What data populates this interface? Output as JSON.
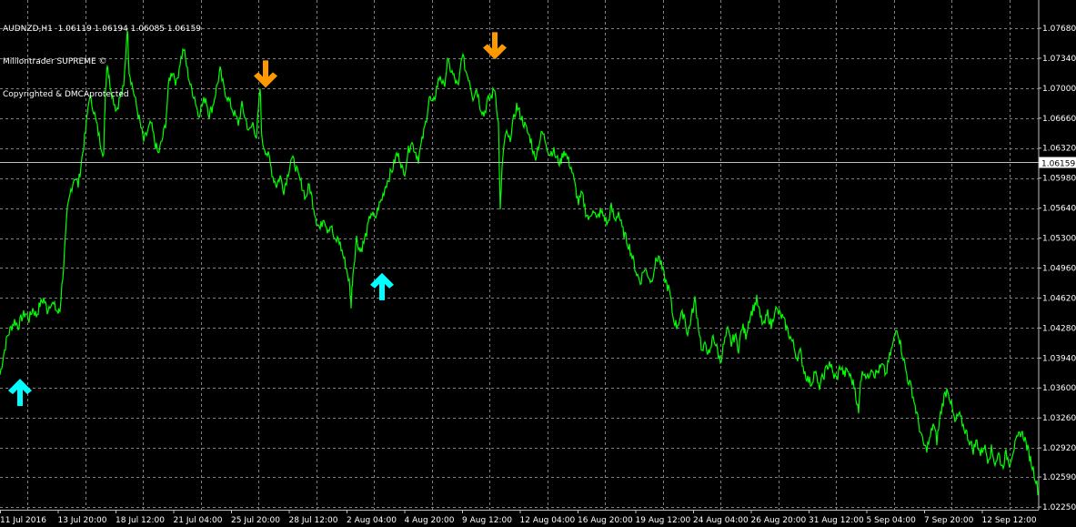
{
  "header": {
    "symbol_line": "AUDNZD,H1  1.06119 1.06194 1.06085 1.06159",
    "indicator_name": "Milliontrader SUPREME ©",
    "copyright": "Copyrighted & DMCAprotected"
  },
  "colors": {
    "background": "#000000",
    "grid": "#7f7f7f",
    "price_line": "#00ff00",
    "buy_arrow": "#00ffff",
    "sell_arrow": "#ff9900",
    "current_price_line": "#c0c0c0",
    "axis_text": "#ffffff"
  },
  "chart_data": {
    "type": "line",
    "symbol": "AUDNZD",
    "timeframe": "H1",
    "ohlc_last": {
      "open": 1.06119,
      "high": 1.06194,
      "low": 1.06085,
      "close": 1.06159
    },
    "current_price": 1.06159,
    "current_price_label": "1.06159",
    "ylim": [
      1.0225,
      1.079
    ],
    "y_ticks": [
      "1.07680",
      "1.07340",
      "1.07000",
      "1.06660",
      "1.06320",
      "1.05980",
      "1.05640",
      "1.05300",
      "1.04960",
      "1.04620",
      "1.04280",
      "1.03940",
      "1.03600",
      "1.03260",
      "1.02920",
      "1.02590",
      "1.02250"
    ],
    "x_ticks": [
      "11 Jul 2016",
      "13 Jul 20:00",
      "18 Jul 12:00",
      "21 Jul 04:00",
      "25 Jul 20:00",
      "28 Jul 12:00",
      "2 Aug 04:00",
      "4 Aug 20:00",
      "9 Aug 12:00",
      "12 Aug 04:00",
      "16 Aug 20:00",
      "19 Aug 12:00",
      "24 Aug 04:00",
      "26 Aug 20:00",
      "31 Aug 12:00",
      "5 Sep 04:00",
      "7 Sep 20:00",
      "12 Sep 12:00"
    ],
    "x_range": [
      0,
      1140
    ],
    "x_tick_positions": [
      0,
      63.5,
      127,
      190.5,
      254,
      317.5,
      381,
      444.5,
      508,
      571.5,
      635,
      698.5,
      762,
      825.5,
      889,
      952.5,
      1016,
      1079.5
    ],
    "series": [
      {
        "points": [
          [
            0,
            1.0375
          ],
          [
            4,
            1.0398
          ],
          [
            8,
            1.0418
          ],
          [
            12,
            1.0428
          ],
          [
            16,
            1.0436
          ],
          [
            20,
            1.043
          ],
          [
            24,
            1.044
          ],
          [
            28,
            1.0445
          ],
          [
            32,
            1.0438
          ],
          [
            36,
            1.045
          ],
          [
            40,
            1.0442
          ],
          [
            44,
            1.0455
          ],
          [
            48,
            1.0461
          ],
          [
            52,
            1.0448
          ],
          [
            56,
            1.0458
          ],
          [
            60,
            1.0452
          ],
          [
            64,
            1.0445
          ],
          [
            66,
            1.045
          ],
          [
            70,
            1.05
          ],
          [
            74,
            1.056
          ],
          [
            78,
            1.0585
          ],
          [
            82,
            1.06
          ],
          [
            86,
            1.059
          ],
          [
            90,
            1.062
          ],
          [
            94,
            1.065
          ],
          [
            98,
            1.069
          ],
          [
            102,
            1.068
          ],
          [
            106,
            1.066
          ],
          [
            110,
            1.064
          ],
          [
            114,
            1.0625
          ],
          [
            116,
            1.07
          ],
          [
            118,
            1.073
          ],
          [
            120,
            1.071
          ],
          [
            124,
            1.069
          ],
          [
            128,
            1.0675
          ],
          [
            132,
            1.069
          ],
          [
            136,
            1.07
          ],
          [
            140,
            1.077
          ],
          [
            142,
            1.072
          ],
          [
            146,
            1.07
          ],
          [
            150,
            1.068
          ],
          [
            154,
            1.066
          ],
          [
            158,
            1.064
          ],
          [
            162,
            1.065
          ],
          [
            166,
            1.066
          ],
          [
            170,
            1.064
          ],
          [
            174,
            1.0625
          ],
          [
            178,
            1.064
          ],
          [
            182,
            1.066
          ],
          [
            186,
            1.071
          ],
          [
            190,
            1.072
          ],
          [
            194,
            1.0705
          ],
          [
            198,
            1.073
          ],
          [
            202,
            1.0745
          ],
          [
            206,
            1.072
          ],
          [
            210,
            1.07
          ],
          [
            214,
            1.069
          ],
          [
            218,
            1.067
          ],
          [
            222,
            1.068
          ],
          [
            226,
            1.069
          ],
          [
            230,
            1.067
          ],
          [
            234,
            1.068
          ],
          [
            238,
            1.07
          ],
          [
            242,
            1.072
          ],
          [
            246,
            1.07
          ],
          [
            250,
            1.069
          ],
          [
            254,
            1.068
          ],
          [
            258,
            1.067
          ],
          [
            262,
            1.066
          ],
          [
            266,
            1.068
          ],
          [
            270,
            1.0665
          ],
          [
            274,
            1.065
          ],
          [
            278,
            1.066
          ],
          [
            282,
            1.0645
          ],
          [
            286,
            1.07
          ],
          [
            288,
            1.064
          ],
          [
            292,
            1.063
          ],
          [
            296,
            1.062
          ],
          [
            300,
            1.06
          ],
          [
            304,
            1.059
          ],
          [
            308,
            1.06
          ],
          [
            312,
            1.0585
          ],
          [
            316,
            1.06
          ],
          [
            320,
            1.062
          ],
          [
            324,
            1.0615
          ],
          [
            328,
            1.06
          ],
          [
            332,
            1.059
          ],
          [
            336,
            1.0575
          ],
          [
            340,
            1.059
          ],
          [
            344,
            1.057
          ],
          [
            348,
            1.055
          ],
          [
            352,
            1.054
          ],
          [
            356,
            1.0555
          ],
          [
            360,
            1.054
          ],
          [
            364,
            1.0545
          ],
          [
            368,
            1.0525
          ],
          [
            372,
            1.053
          ],
          [
            376,
            1.0515
          ],
          [
            380,
            1.05
          ],
          [
            384,
            1.048
          ],
          [
            386,
            1.0455
          ],
          [
            388,
            1.049
          ],
          [
            392,
            1.053
          ],
          [
            396,
            1.0515
          ],
          [
            400,
            1.0525
          ],
          [
            404,
            1.054
          ],
          [
            408,
            1.056
          ],
          [
            412,
            1.055
          ],
          [
            416,
            1.0565
          ],
          [
            420,
            1.0575
          ],
          [
            424,
            1.059
          ],
          [
            428,
            1.06
          ],
          [
            432,
            1.061
          ],
          [
            436,
            1.0625
          ],
          [
            440,
            1.062
          ],
          [
            444,
            1.06
          ],
          [
            448,
            1.0625
          ],
          [
            452,
            1.064
          ],
          [
            456,
            1.063
          ],
          [
            460,
            1.062
          ],
          [
            464,
            1.064
          ],
          [
            468,
            1.066
          ],
          [
            472,
            1.069
          ],
          [
            476,
            1.068
          ],
          [
            480,
            1.07
          ],
          [
            484,
            1.0715
          ],
          [
            488,
            1.07
          ],
          [
            492,
            1.073
          ],
          [
            496,
            1.072
          ],
          [
            500,
            1.071
          ],
          [
            504,
            1.07
          ],
          [
            508,
            1.074
          ],
          [
            512,
            1.072
          ],
          [
            516,
            1.071
          ],
          [
            520,
            1.069
          ],
          [
            524,
            1.07
          ],
          [
            528,
            1.068
          ],
          [
            532,
            1.067
          ],
          [
            536,
            1.0685
          ],
          [
            540,
            1.069
          ],
          [
            544,
            1.07
          ],
          [
            548,
            1.066
          ],
          [
            550,
            1.056
          ],
          [
            552,
            1.061
          ],
          [
            556,
            1.065
          ],
          [
            560,
            1.064
          ],
          [
            564,
            1.066
          ],
          [
            568,
            1.068
          ],
          [
            572,
            1.067
          ],
          [
            576,
            1.066
          ],
          [
            580,
            1.065
          ],
          [
            584,
            1.064
          ],
          [
            588,
            1.062
          ],
          [
            592,
            1.0635
          ],
          [
            596,
            1.065
          ],
          [
            600,
            1.064
          ],
          [
            604,
            1.0625
          ],
          [
            608,
            1.063
          ],
          [
            612,
            1.062
          ],
          [
            616,
            1.0615
          ],
          [
            620,
            1.063
          ],
          [
            624,
            1.062
          ],
          [
            628,
            1.061
          ],
          [
            632,
            1.059
          ],
          [
            636,
            1.057
          ],
          [
            640,
            1.058
          ],
          [
            644,
            1.056
          ],
          [
            648,
            1.055
          ],
          [
            652,
            1.0565
          ],
          [
            656,
            1.055
          ],
          [
            660,
            1.056
          ],
          [
            664,
            1.0555
          ],
          [
            668,
            1.0545
          ],
          [
            672,
            1.0565
          ],
          [
            676,
            1.055
          ],
          [
            680,
            1.056
          ],
          [
            684,
            1.054
          ],
          [
            688,
            1.053
          ],
          [
            692,
            1.052
          ],
          [
            696,
            1.0505
          ],
          [
            700,
            1.049
          ],
          [
            704,
            1.048
          ],
          [
            708,
            1.0495
          ],
          [
            712,
            1.049
          ],
          [
            716,
            1.048
          ],
          [
            720,
            1.05
          ],
          [
            724,
            1.051
          ],
          [
            728,
            1.0495
          ],
          [
            732,
            1.048
          ],
          [
            736,
            1.047
          ],
          [
            740,
            1.044
          ],
          [
            744,
            1.043
          ],
          [
            748,
            1.044
          ],
          [
            752,
            1.0445
          ],
          [
            756,
            1.042
          ],
          [
            760,
            1.044
          ],
          [
            764,
            1.046
          ],
          [
            768,
            1.043
          ],
          [
            772,
            1.04
          ],
          [
            776,
            1.041
          ],
          [
            780,
            1.0395
          ],
          [
            784,
            1.042
          ],
          [
            788,
            1.0405
          ],
          [
            792,
            1.039
          ],
          [
            796,
            1.041
          ],
          [
            800,
            1.0425
          ],
          [
            804,
            1.041
          ],
          [
            808,
            1.042
          ],
          [
            812,
            1.0405
          ],
          [
            816,
            1.043
          ],
          [
            820,
            1.042
          ],
          [
            824,
            1.044
          ],
          [
            828,
            1.045
          ],
          [
            832,
            1.046
          ],
          [
            836,
            1.044
          ],
          [
            840,
            1.043
          ],
          [
            844,
            1.0445
          ],
          [
            848,
            1.043
          ],
          [
            852,
            1.045
          ],
          [
            856,
            1.0445
          ],
          [
            860,
            1.044
          ],
          [
            864,
            1.043
          ],
          [
            868,
            1.042
          ],
          [
            872,
            1.041
          ],
          [
            876,
            1.0395
          ],
          [
            880,
            1.04
          ],
          [
            884,
            1.038
          ],
          [
            888,
            1.037
          ],
          [
            892,
            1.0365
          ],
          [
            896,
            1.038
          ],
          [
            900,
            1.036
          ],
          [
            904,
            1.037
          ],
          [
            908,
            1.038
          ],
          [
            912,
            1.039
          ],
          [
            916,
            1.0375
          ],
          [
            920,
            1.037
          ],
          [
            924,
            1.0385
          ],
          [
            928,
            1.0375
          ],
          [
            932,
            1.038
          ],
          [
            936,
            1.037
          ],
          [
            940,
            1.036
          ],
          [
            944,
            1.033
          ],
          [
            946,
            1.037
          ],
          [
            950,
            1.038
          ],
          [
            954,
            1.037
          ],
          [
            958,
            1.0385
          ],
          [
            962,
            1.0375
          ],
          [
            966,
            1.038
          ],
          [
            970,
            1.0385
          ],
          [
            974,
            1.0375
          ],
          [
            978,
            1.0395
          ],
          [
            982,
            1.041
          ],
          [
            986,
            1.043
          ],
          [
            990,
            1.041
          ],
          [
            994,
            1.039
          ],
          [
            998,
            1.037
          ],
          [
            1002,
            1.036
          ],
          [
            1006,
            1.034
          ],
          [
            1010,
            1.032
          ],
          [
            1014,
            1.03
          ],
          [
            1018,
            1.029
          ],
          [
            1022,
            1.03
          ],
          [
            1026,
            1.032
          ],
          [
            1030,
            1.03
          ],
          [
            1034,
            1.033
          ],
          [
            1038,
            1.035
          ],
          [
            1042,
            1.036
          ],
          [
            1046,
            1.034
          ],
          [
            1050,
            1.032
          ],
          [
            1054,
            1.033
          ],
          [
            1058,
            1.032
          ],
          [
            1062,
            1.031
          ],
          [
            1066,
            1.03
          ],
          [
            1070,
            1.029
          ],
          [
            1074,
            1.03
          ],
          [
            1078,
            1.0285
          ],
          [
            1082,
            1.0295
          ],
          [
            1086,
            1.028
          ],
          [
            1090,
            1.029
          ],
          [
            1094,
            1.0275
          ],
          [
            1098,
            1.0285
          ],
          [
            1102,
            1.027
          ],
          [
            1106,
            1.0285
          ],
          [
            1110,
            1.0275
          ],
          [
            1114,
            1.029
          ],
          [
            1118,
            1.03
          ],
          [
            1122,
            1.031
          ],
          [
            1126,
            1.0305
          ],
          [
            1130,
            1.029
          ],
          [
            1134,
            1.0275
          ],
          [
            1138,
            1.026
          ],
          [
            1142,
            1.024
          ]
        ]
      }
    ],
    "signals": [
      {
        "type": "buy",
        "x": 22,
        "price": 1.0355
      },
      {
        "type": "sell",
        "x": 292,
        "price": 1.0716
      },
      {
        "type": "buy",
        "x": 420,
        "price": 1.0475
      },
      {
        "type": "sell",
        "x": 544,
        "price": 1.0748
      }
    ],
    "grid": true
  }
}
